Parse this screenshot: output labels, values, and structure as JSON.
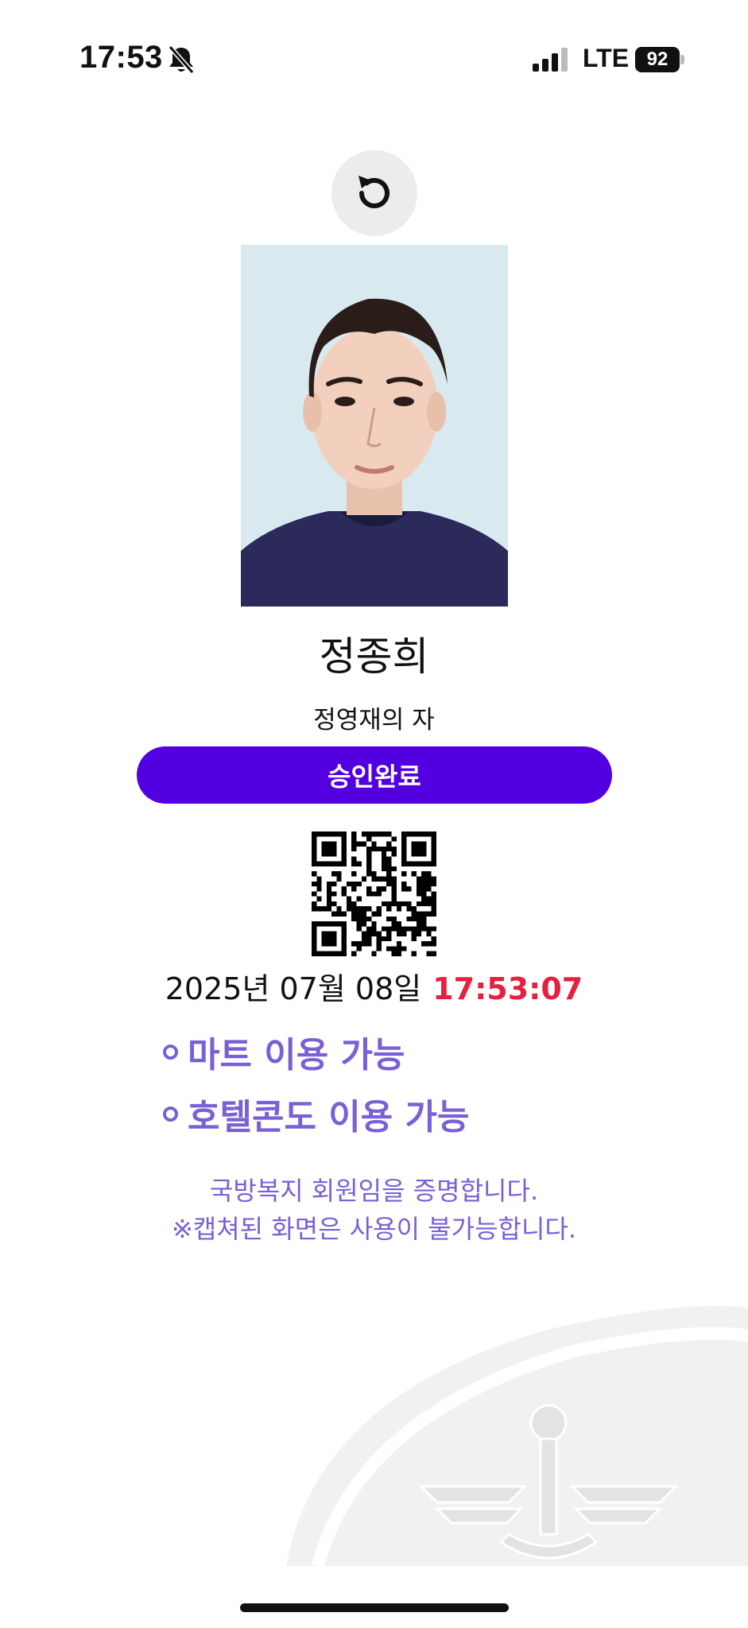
{
  "status_bar": {
    "time": "17:53",
    "network": "LTE",
    "battery": "92",
    "icons": [
      "bell-off-icon",
      "signal-icon",
      "battery-icon"
    ]
  },
  "refresh": {
    "icon": "refresh-icon"
  },
  "member": {
    "name": "정종희",
    "relation": "정영재의 자",
    "status": "승인완료"
  },
  "datetime": {
    "date": "2025년 07월 08일",
    "time": "17:53:07"
  },
  "benefits": [
    {
      "label": "마트 이용 가능"
    },
    {
      "label": "호텔콘도 이용 가능"
    }
  ],
  "notice": {
    "line1": "국방복지 회원임을 증명합니다.",
    "line2": "※캡쳐된 화면은 사용이 불가능합니다."
  },
  "colors": {
    "accent": "#5200e0",
    "benefit_text": "#7a60d6",
    "time_red": "#e6213f"
  }
}
